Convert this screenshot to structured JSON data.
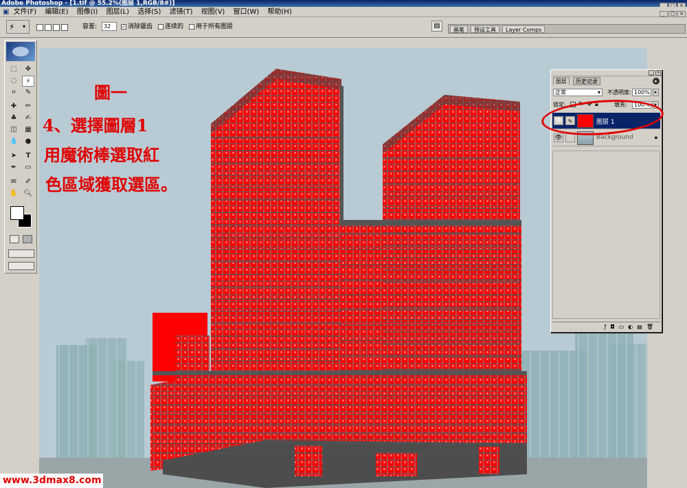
{
  "window": {
    "title": "Adobe Photoshop - [1.tif @ 55.2%(图层 1,RGB/8#)]"
  },
  "menu": {
    "items": [
      "文件(F)",
      "编辑(E)",
      "图像(I)",
      "图层(L)",
      "选择(S)",
      "滤镜(T)",
      "视图(V)",
      "窗口(W)",
      "帮助(H)"
    ]
  },
  "options": {
    "tolerance_label": "容差:",
    "tolerance_value": "32",
    "antialias_label": "消除锯齿",
    "contiguous_label": "连续的",
    "all_layers_label": "用于所有图层"
  },
  "palette_well": {
    "tabs": [
      "画笔",
      "预设工具",
      "Layer Comps"
    ]
  },
  "annotation": {
    "title": "圖一",
    "line1": "4、選擇圖層1",
    "line2": "用魔術棒選取紅",
    "line3": "色區域獲取選區。"
  },
  "layers_panel": {
    "tabs": [
      "图层",
      "历史记录"
    ],
    "blend_mode": "正常",
    "opacity_label": "不透明度:",
    "opacity_value": "100%",
    "lock_label": "锁定:",
    "fill_label": "填充:",
    "fill_value": "100%",
    "layers": [
      {
        "name": "图层 1",
        "selected": true
      },
      {
        "name": "Background",
        "selected": false
      }
    ]
  },
  "watermark": {
    "text": "www.3dmax8.com"
  },
  "colors": {
    "highlight_red": "#e00000",
    "building_red": "#ff0000",
    "selection_blue": "#0a246a"
  }
}
